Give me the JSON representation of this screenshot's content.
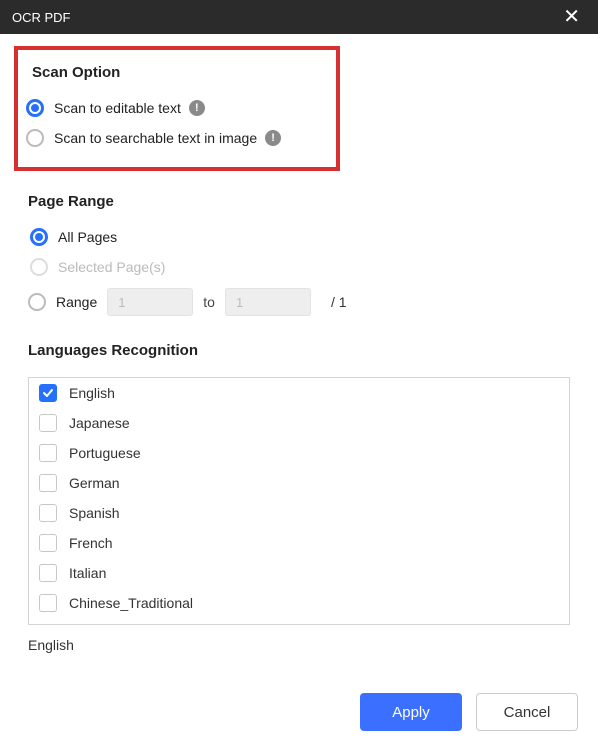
{
  "titlebar": {
    "title": "OCR PDF"
  },
  "scanOption": {
    "title": "Scan Option",
    "opt1": "Scan to editable text",
    "opt2": "Scan to searchable text in image"
  },
  "pageRange": {
    "title": "Page Range",
    "allPages": "All Pages",
    "selectedPages": "Selected Page(s)",
    "rangeLabel": "Range",
    "toLabel": "to",
    "fromValue": "1",
    "toValue": "1",
    "totalLabel": "/ 1"
  },
  "languages": {
    "title": "Languages Recognition",
    "items": [
      {
        "label": "English",
        "checked": true
      },
      {
        "label": "Japanese",
        "checked": false
      },
      {
        "label": "Portuguese",
        "checked": false
      },
      {
        "label": "German",
        "checked": false
      },
      {
        "label": "Spanish",
        "checked": false
      },
      {
        "label": "French",
        "checked": false
      },
      {
        "label": "Italian",
        "checked": false
      },
      {
        "label": "Chinese_Traditional",
        "checked": false
      }
    ],
    "selectedSummary": "English"
  },
  "footer": {
    "apply": "Apply",
    "cancel": "Cancel"
  }
}
